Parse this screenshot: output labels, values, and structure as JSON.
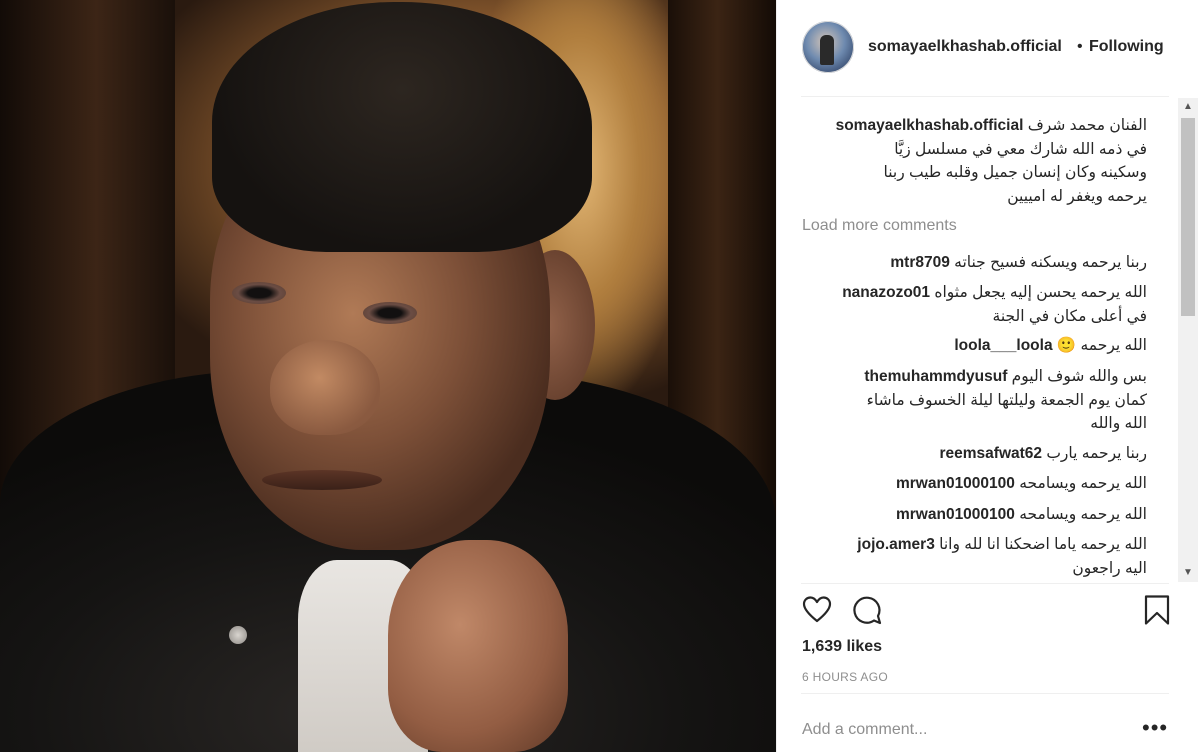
{
  "header": {
    "username": "somayaelkhashab.official",
    "separator": "•",
    "follow_status": "Following"
  },
  "caption": {
    "username": "somayaelkhashab.official",
    "lines": [
      "الفنان محمد شرف",
      "في ذمه الله شارك معي في مسلسل زيَّا",
      "وسكينه وكان إنسان جميل وقلبه طيب ربنا",
      "يرحمه ويغفر له امييين"
    ]
  },
  "load_more": "Load more comments",
  "comments": [
    {
      "username": "mtr8709",
      "lines": [
        "ربنا يرحمه ويسكنه فسيح جناته"
      ]
    },
    {
      "username": "nanazozo01",
      "lines": [
        "الله يرحمه يحسن إليه يجعل مثواه",
        "في أعلى مكان في الجنة"
      ]
    },
    {
      "username": "loola___loola",
      "lines": [
        "الله يرحمه 🙂"
      ]
    },
    {
      "username": "themuhammdyusuf",
      "lines": [
        "بس والله شوف اليوم",
        "كمان يوم الجمعة وليلتها ليلة الخسوف ماشاء",
        "الله والله"
      ]
    },
    {
      "username": "reemsafwat62",
      "lines": [
        "ربنا يرحمه يارب"
      ]
    },
    {
      "username": "mrwan01000100",
      "lines": [
        "الله يرحمه ويسامحه"
      ]
    },
    {
      "username": "mrwan01000100",
      "lines": [
        "الله يرحمه ويسامحه"
      ]
    },
    {
      "username": "jojo.amer3",
      "lines": [
        "الله يرحمه ياما اضحكنا انا لله وانا",
        "اليه راجعون"
      ]
    }
  ],
  "icons": {
    "like": "heart-icon",
    "comment": "comment-icon",
    "save": "bookmark-icon",
    "options": "more-options-icon"
  },
  "likes": "1,639 likes",
  "timestamp": "6 HOURS AGO",
  "add_comment_placeholder": "Add a comment...",
  "more_options": "•••"
}
